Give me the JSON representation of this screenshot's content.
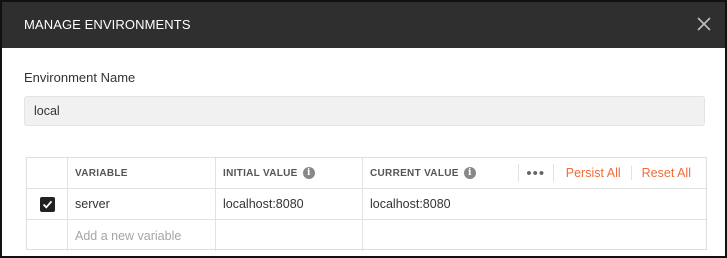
{
  "modal": {
    "title": "MANAGE ENVIRONMENTS",
    "close_icon": "close-icon"
  },
  "environment": {
    "label": "Environment Name",
    "value": "local"
  },
  "table": {
    "headers": {
      "variable": "VARIABLE",
      "initial_value": "INITIAL VALUE",
      "current_value": "CURRENT VALUE",
      "info_glyph": "i"
    },
    "actions": {
      "more": "•••",
      "persist_all": "Persist All",
      "reset_all": "Reset All"
    },
    "rows": [
      {
        "enabled": true,
        "variable": "server",
        "initial_value": "localhost:8080",
        "current_value": "localhost:8080"
      }
    ],
    "new_row_placeholder": "Add a new variable"
  },
  "colors": {
    "accent": "#f26b3a",
    "header_bg": "#2f2f2f"
  }
}
